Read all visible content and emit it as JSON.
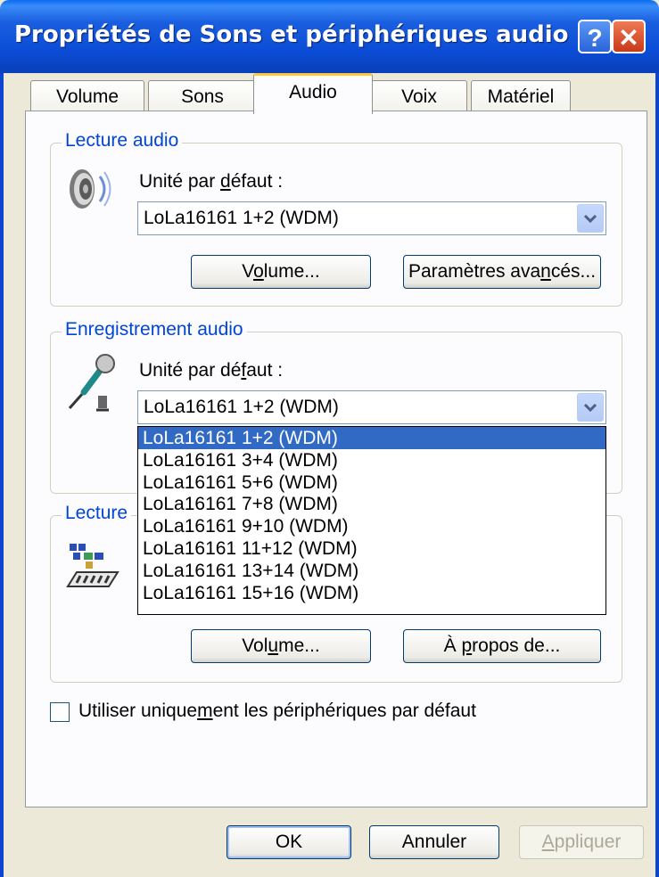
{
  "window": {
    "title": "Propriétés de Sons et périphériques audio",
    "help_glyph": "?",
    "close_glyph": "✕"
  },
  "tabs": [
    {
      "label": "Volume"
    },
    {
      "label": "Sons"
    },
    {
      "label": "Audio",
      "active": true
    },
    {
      "label": "Voix"
    },
    {
      "label": "Matériel"
    }
  ],
  "playback": {
    "group_label": "Lecture audio",
    "device_label_pre": "Unité par ",
    "device_label_u": "d",
    "device_label_post": "éfaut :",
    "selected": "LoLa16161 1+2 (WDM)",
    "volume_pre": "V",
    "volume_u": "o",
    "volume_post": "lume...",
    "advanced_pre": "Paramètres ava",
    "advanced_u": "n",
    "advanced_post": "cés...",
    "icon": "speaker-icon"
  },
  "recording": {
    "group_label": "Enregistrement audio",
    "device_label_pre": "Unité par dé",
    "device_label_u": "f",
    "device_label_post": "aut :",
    "selected": "LoLa16161 1+2 (WDM)",
    "icon": "microphone-icon",
    "options": [
      "LoLa16161 1+2 (WDM)",
      "LoLa16161 3+4 (WDM)",
      "LoLa16161 5+6 (WDM)",
      "LoLa16161 7+8 (WDM)",
      "LoLa16161 9+10 (WDM)",
      "LoLa16161 11+12 (WDM)",
      "LoLa16161 13+14 (WDM)",
      "LoLa16161 15+16 (WDM)"
    ],
    "highlighted_index": 0
  },
  "midi": {
    "group_label": "Lecture",
    "volume_pre": "Vol",
    "volume_u": "u",
    "volume_post": "me...",
    "about_pre": "À ",
    "about_u": "p",
    "about_post": "ropos de...",
    "icon": "midi-keyboard-icon"
  },
  "options": {
    "default_only_pre": "Utiliser unique",
    "default_only_u": "m",
    "default_only_post": "ent les périphériques par défaut",
    "default_only_checked": false
  },
  "footer": {
    "ok": "OK",
    "cancel": "Annuler",
    "apply_u": "A",
    "apply_post": "ppliquer"
  }
}
